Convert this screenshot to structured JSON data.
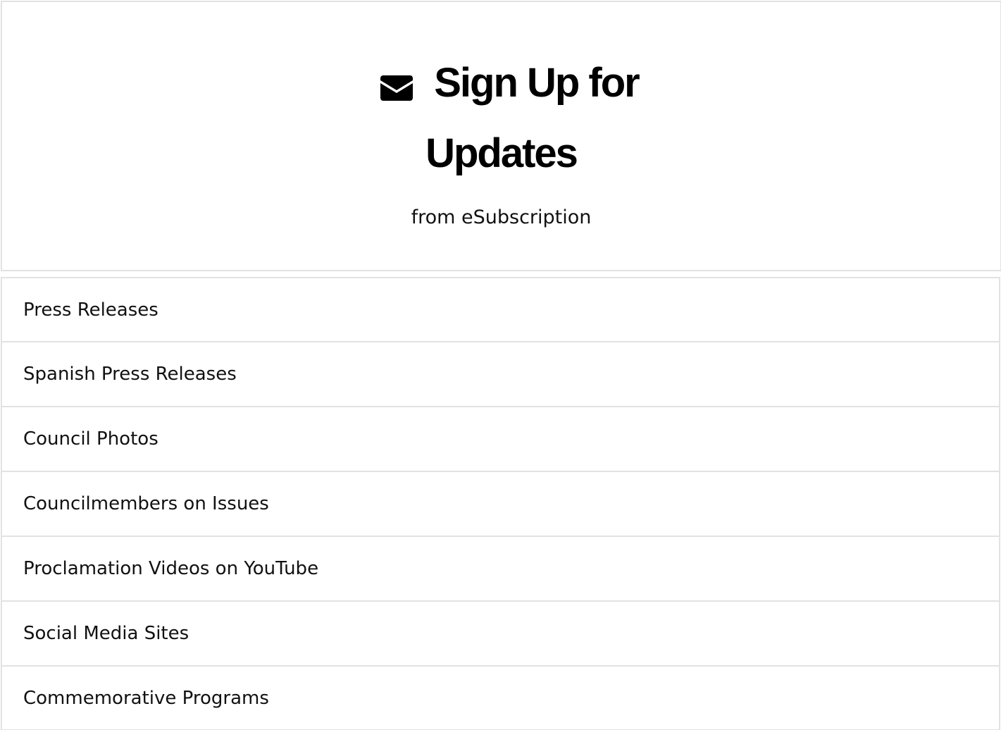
{
  "signup": {
    "icon": "envelope-icon",
    "title_line1": "Sign Up for",
    "title_line2": "Updates",
    "subtitle": "from eSubscription"
  },
  "topics": [
    {
      "label": "Press Releases"
    },
    {
      "label": "Spanish Press Releases"
    },
    {
      "label": "Council Photos"
    },
    {
      "label": "Councilmembers on Issues"
    },
    {
      "label": "Proclamation Videos on YouTube"
    },
    {
      "label": "Social Media Sites"
    },
    {
      "label": "Commemorative Programs"
    }
  ],
  "colors": {
    "border": "#e2e2e2",
    "text": "#111111",
    "title": "#000000"
  }
}
